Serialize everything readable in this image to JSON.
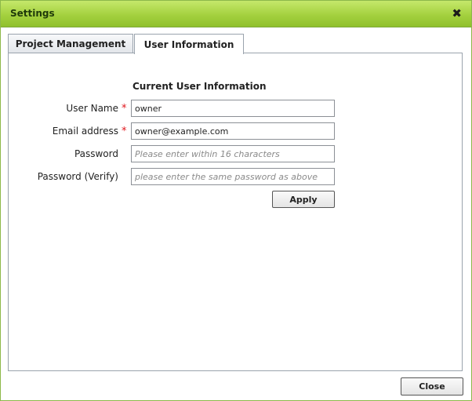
{
  "dialog": {
    "title": "Settings",
    "close_icon_glyph": "✖"
  },
  "tabs": [
    {
      "label": "Project Management",
      "active": false
    },
    {
      "label": "User Information",
      "active": true
    }
  ],
  "form": {
    "section_title": "Current User Information",
    "fields": [
      {
        "label": "User Name",
        "required": true,
        "value": "owner",
        "placeholder": ""
      },
      {
        "label": "Email address",
        "required": true,
        "value": "owner@example.com",
        "placeholder": ""
      },
      {
        "label": "Password",
        "required": false,
        "value": "",
        "placeholder": "Please enter within 16 characters"
      },
      {
        "label": "Password (Verify)",
        "required": false,
        "value": "",
        "placeholder": "please enter the same password as above"
      }
    ],
    "required_marker": "*",
    "apply_label": "Apply"
  },
  "footer": {
    "close_label": "Close"
  },
  "colors": {
    "titlebar_accent": "#a4d13f",
    "required": "#e0151b"
  }
}
